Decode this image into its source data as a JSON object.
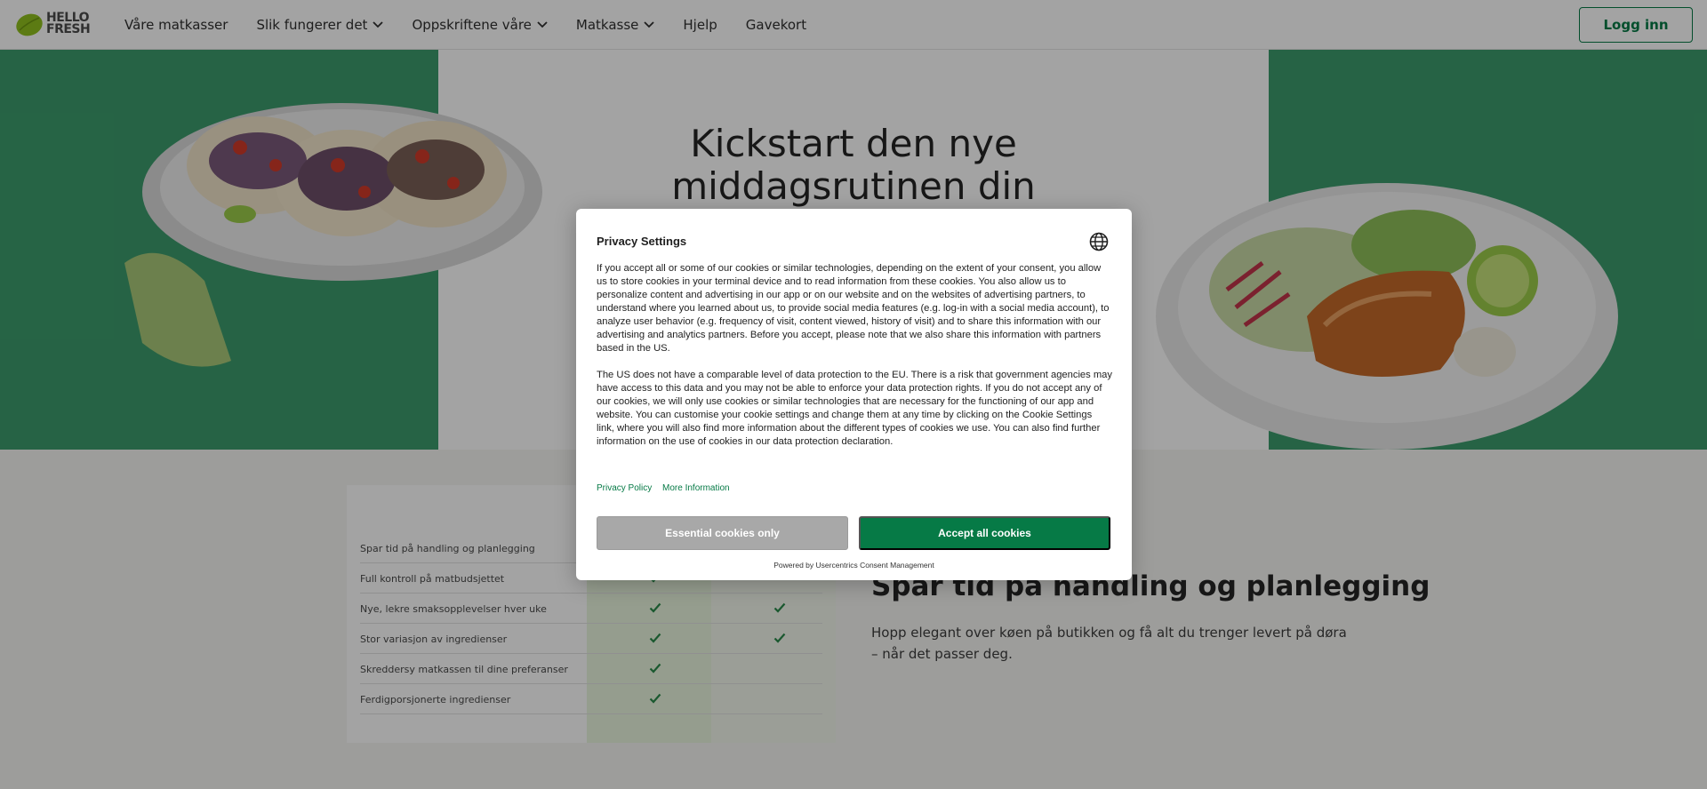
{
  "header": {
    "logo_line1": "HELLO",
    "logo_line2": "FRESH",
    "nav": [
      {
        "label": "Våre matkasser",
        "dropdown": false
      },
      {
        "label": "Slik fungerer det",
        "dropdown": true
      },
      {
        "label": "Oppskriftene våre",
        "dropdown": true
      },
      {
        "label": "Matkasse",
        "dropdown": true
      },
      {
        "label": "Hjelp",
        "dropdown": false
      },
      {
        "label": "Gavekort",
        "dropdown": false
      }
    ],
    "login_label": "Logg inn"
  },
  "hero": {
    "title_line1": "Kickstart den nye",
    "title_line2": "middagsrutinen din"
  },
  "comparison": {
    "rows": [
      {
        "label": "Spar tid på handling og planlegging",
        "col1": false,
        "col2": false
      },
      {
        "label": "Full kontroll på matbudsjettet",
        "col1": true,
        "col2": false
      },
      {
        "label": "Nye, lekre smaksopplevelser hver uke",
        "col1": true,
        "col2": true
      },
      {
        "label": "Stor variasjon av ingredienser",
        "col1": true,
        "col2": true
      },
      {
        "label": "Skreddersy matkassen til dine preferanser",
        "col1": true,
        "col2": false
      },
      {
        "label": "Ferdigporsjonerte ingredienser",
        "col1": true,
        "col2": false
      }
    ]
  },
  "info": {
    "title": "Spar tid på handling og planlegging",
    "text": "Hopp elegant over køen på butikken og få alt du trenger levert på døra – når det passer deg."
  },
  "consent": {
    "title": "Privacy Settings",
    "paragraph1": "If you accept all or some of our cookies or similar technologies, depending on the extent of your consent, you allow us to store cookies in your terminal device and to read information from these cookies. You also allow us to personalize content and advertising in our app or on our website and on the websites of advertising partners, to understand where you learned about us, to provide social media features (e.g. log-in with a social media account), to analyze user behavior (e.g. frequency of visit, content viewed, history of visit) and to share this information with our advertising and analytics partners. Before you accept, please note that we also share this information with partners based in the US.",
    "paragraph2": "The US does not have a comparable level of data protection to the EU. There is a risk that government agencies may have access to this data and you may not be able to enforce your data protection rights. If you do not accept any of our cookies, we will only use cookies or similar technologies that are necessary for the functioning of our app and website. You can customise your cookie settings and change them at any time by clicking on the Cookie Settings link, where you will also find more information about the different types of cookies we use. You can also find further information on the use of cookies in our data protection declaration.",
    "link_privacy": "Privacy Policy",
    "link_more": "More Information",
    "btn_essential": "Essential cookies only",
    "btn_accept": "Accept all cookies",
    "powered_by": "Powered by Usercentrics Consent Management"
  },
  "colors": {
    "brand_green": "#067a46",
    "hero_green": "#3c9c6c",
    "lime": "#91c11e"
  },
  "icons": [
    "hellofresh-lime-logo",
    "chevron-down-icon",
    "check-icon",
    "globe-icon"
  ]
}
